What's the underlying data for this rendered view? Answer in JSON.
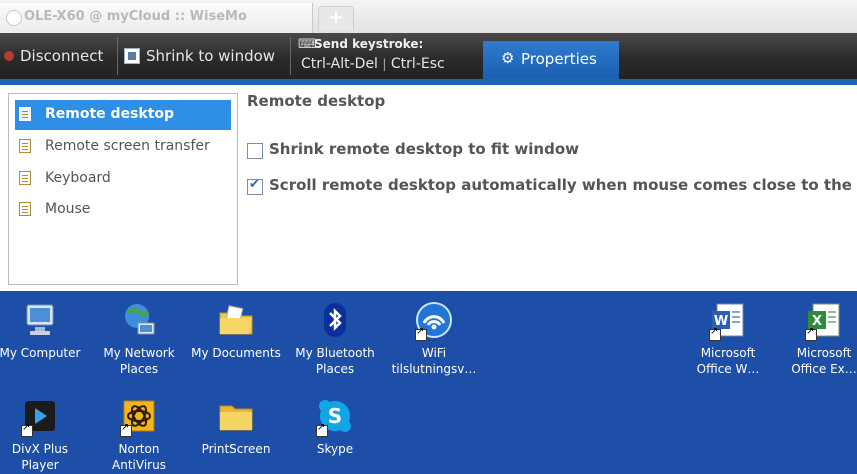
{
  "browser": {
    "tab_title": "OLE-X60 @ myCloud :: WiseMo",
    "new_tab_label": "+"
  },
  "toolbar": {
    "disconnect_label": "Disconnect",
    "shrink_label": "Shrink to window",
    "send_keystroke_label": "Send keystroke:",
    "ctrl_alt_del_label": "Ctrl-Alt-Del",
    "key_separator": "|",
    "ctrl_esc_label": "Ctrl-Esc",
    "properties_label": "Properties"
  },
  "nav": {
    "items": [
      {
        "label": "Remote desktop",
        "active": true
      },
      {
        "label": "Remote screen transfer",
        "active": false
      },
      {
        "label": "Keyboard",
        "active": false
      },
      {
        "label": "Mouse",
        "active": false
      }
    ]
  },
  "main": {
    "title": "Remote desktop",
    "options": [
      {
        "label": "Shrink remote desktop to fit window",
        "checked": false
      },
      {
        "label": "Scroll remote desktop automatically when mouse comes close to the b",
        "checked": true
      }
    ]
  },
  "desktop": {
    "icons": [
      {
        "label": "My Computer",
        "icon": "computer-icon"
      },
      {
        "label": "My Network\nPlaces",
        "icon": "network-places-icon"
      },
      {
        "label": "My Documents",
        "icon": "documents-folder-icon"
      },
      {
        "label": "My Bluetooth\nPlaces",
        "icon": "bluetooth-icon"
      },
      {
        "label": "WiFi\ntilslutningsv…",
        "icon": "wifi-icon"
      },
      {
        "label": "Microsoft\nOffice W…",
        "icon": "word-icon"
      },
      {
        "label": "Microsoft\nOffice Ex…",
        "icon": "excel-icon"
      },
      {
        "label": "DivX Plus\nPlayer",
        "icon": "divx-icon"
      },
      {
        "label": "Norton\nAntiVirus",
        "icon": "norton-icon"
      },
      {
        "label": "PrintScreen",
        "icon": "folder-icon"
      },
      {
        "label": "Skype",
        "icon": "skype-icon"
      }
    ]
  },
  "colors": {
    "toolbar_bg": "#2b2b2b",
    "accent_blue": "#1e63b6",
    "nav_active": "#2f8fe6",
    "desktop_bg": "#1d4fa8"
  }
}
